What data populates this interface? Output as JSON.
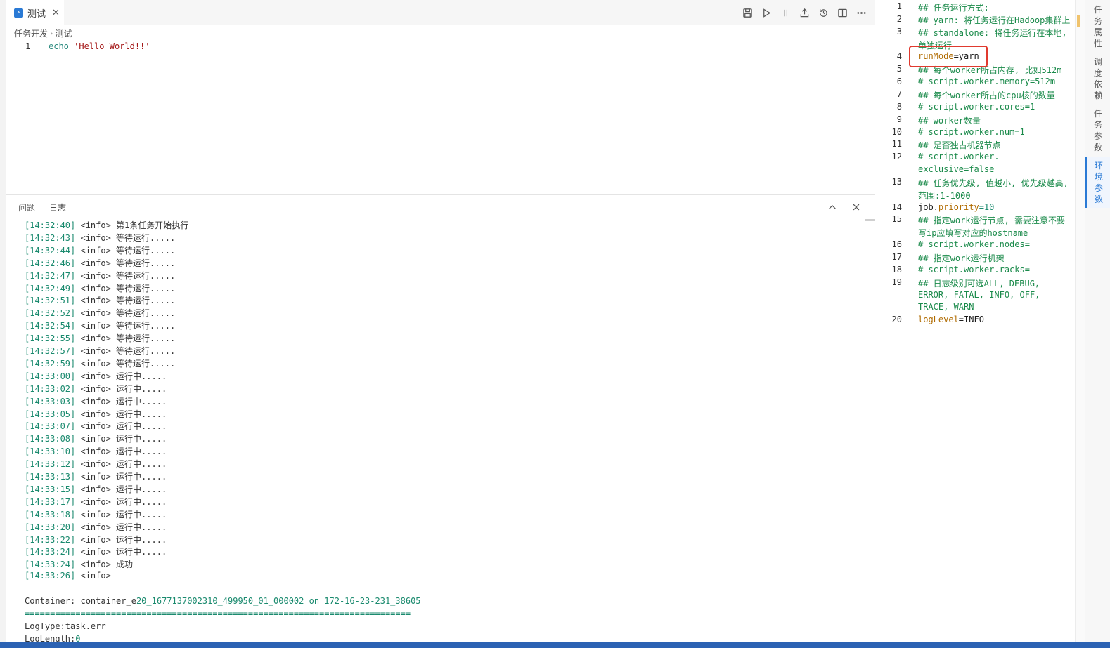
{
  "tab": {
    "title": "测试",
    "close": "✕",
    "icon": "terminal-icon"
  },
  "breadcrumb": {
    "root": "任务开发",
    "sep": "›",
    "current": "测试"
  },
  "editor": {
    "line_number": "1",
    "keyword": "echo",
    "string": "'Hello World!!'"
  },
  "panel": {
    "tabs": [
      "问题",
      "日志"
    ],
    "active_tab": "日志"
  },
  "log": {
    "lines": [
      {
        "ts": "[14:32:40]",
        "level": "<info>",
        "msg": "第1条任务开始执行"
      },
      {
        "ts": "[14:32:43]",
        "level": "<info>",
        "msg": "等待运行....."
      },
      {
        "ts": "[14:32:44]",
        "level": "<info>",
        "msg": "等待运行....."
      },
      {
        "ts": "[14:32:46]",
        "level": "<info>",
        "msg": "等待运行....."
      },
      {
        "ts": "[14:32:47]",
        "level": "<info>",
        "msg": "等待运行....."
      },
      {
        "ts": "[14:32:49]",
        "level": "<info>",
        "msg": "等待运行....."
      },
      {
        "ts": "[14:32:51]",
        "level": "<info>",
        "msg": "等待运行....."
      },
      {
        "ts": "[14:32:52]",
        "level": "<info>",
        "msg": "等待运行....."
      },
      {
        "ts": "[14:32:54]",
        "level": "<info>",
        "msg": "等待运行....."
      },
      {
        "ts": "[14:32:55]",
        "level": "<info>",
        "msg": "等待运行....."
      },
      {
        "ts": "[14:32:57]",
        "level": "<info>",
        "msg": "等待运行....."
      },
      {
        "ts": "[14:32:59]",
        "level": "<info>",
        "msg": "等待运行....."
      },
      {
        "ts": "[14:33:00]",
        "level": "<info>",
        "msg": "运行中....."
      },
      {
        "ts": "[14:33:02]",
        "level": "<info>",
        "msg": "运行中....."
      },
      {
        "ts": "[14:33:03]",
        "level": "<info>",
        "msg": "运行中....."
      },
      {
        "ts": "[14:33:05]",
        "level": "<info>",
        "msg": "运行中....."
      },
      {
        "ts": "[14:33:07]",
        "level": "<info>",
        "msg": "运行中....."
      },
      {
        "ts": "[14:33:08]",
        "level": "<info>",
        "msg": "运行中....."
      },
      {
        "ts": "[14:33:10]",
        "level": "<info>",
        "msg": "运行中....."
      },
      {
        "ts": "[14:33:12]",
        "level": "<info>",
        "msg": "运行中....."
      },
      {
        "ts": "[14:33:13]",
        "level": "<info>",
        "msg": "运行中....."
      },
      {
        "ts": "[14:33:15]",
        "level": "<info>",
        "msg": "运行中....."
      },
      {
        "ts": "[14:33:17]",
        "level": "<info>",
        "msg": "运行中....."
      },
      {
        "ts": "[14:33:18]",
        "level": "<info>",
        "msg": "运行中....."
      },
      {
        "ts": "[14:33:20]",
        "level": "<info>",
        "msg": "运行中....."
      },
      {
        "ts": "[14:33:22]",
        "level": "<info>",
        "msg": "运行中....."
      },
      {
        "ts": "[14:33:24]",
        "level": "<info>",
        "msg": "运行中....."
      },
      {
        "ts": "[14:33:24]",
        "level": "<info>",
        "msg": "成功"
      },
      {
        "ts": "[14:33:26]",
        "level": "<info>",
        "msg": ""
      }
    ],
    "container_prefix": "Container: container_e",
    "container_id": "20_1677137002310_499950_01_000002 on 172-16-23-231_38605",
    "separator": "============================================================================",
    "logtype": "LogType:task.err",
    "loglength_prefix": "LogLength:",
    "loglength_value": "0"
  },
  "config": {
    "lines": [
      {
        "n": "1",
        "parts": [
          {
            "t": "## 任务运行方式:",
            "c": "cm"
          }
        ]
      },
      {
        "n": "2",
        "parts": [
          {
            "t": "## yarn: 将任务运行在Hadoop集群上",
            "c": "cm"
          }
        ]
      },
      {
        "n": "3",
        "parts": [
          {
            "t": "## standalone: 将任务运行在本地,",
            "c": "cm"
          }
        ]
      },
      {
        "n": "",
        "parts": [
          {
            "t": "单独运行",
            "c": "cm"
          }
        ]
      },
      {
        "n": "4",
        "parts": [
          {
            "t": "runMode",
            "c": "key"
          },
          {
            "t": "=yarn",
            "c": "val"
          }
        ]
      },
      {
        "n": "5",
        "parts": [
          {
            "t": "## 每个worker所占内存, 比如512m",
            "c": "cm"
          }
        ]
      },
      {
        "n": "6",
        "parts": [
          {
            "t": "# script.worker.memory=512m",
            "c": "cm"
          }
        ]
      },
      {
        "n": "7",
        "parts": [
          {
            "t": "## 每个worker所占的cpu核的数量",
            "c": "cm"
          }
        ]
      },
      {
        "n": "8",
        "parts": [
          {
            "t": "# script.worker.cores=1",
            "c": "cm"
          }
        ]
      },
      {
        "n": "9",
        "parts": [
          {
            "t": "## worker数量",
            "c": "cm"
          }
        ]
      },
      {
        "n": "10",
        "parts": [
          {
            "t": "# script.worker.num=1",
            "c": "cm"
          }
        ]
      },
      {
        "n": "11",
        "parts": [
          {
            "t": "## 是否独占机器节点",
            "c": "cm"
          }
        ]
      },
      {
        "n": "12",
        "parts": [
          {
            "t": "# script.worker.",
            "c": "cm"
          }
        ]
      },
      {
        "n": "",
        "parts": [
          {
            "t": "exclusive=false",
            "c": "cm"
          }
        ]
      },
      {
        "n": "13",
        "parts": [
          {
            "t": "## 任务优先级, 值越小, 优先级越高,",
            "c": "cm"
          }
        ]
      },
      {
        "n": "",
        "parts": [
          {
            "t": "范围:1-1000",
            "c": "cm"
          }
        ]
      },
      {
        "n": "14",
        "parts": [
          {
            "t": "job.",
            "c": "plain"
          },
          {
            "t": "priority",
            "c": "key"
          },
          {
            "t": "=10",
            "c": "num"
          }
        ]
      },
      {
        "n": "15",
        "parts": [
          {
            "t": "## 指定work运行节点, 需要注意不要",
            "c": "cm"
          }
        ]
      },
      {
        "n": "",
        "parts": [
          {
            "t": "写ip应填写对应的hostname",
            "c": "cm"
          }
        ]
      },
      {
        "n": "16",
        "parts": [
          {
            "t": "# script.worker.nodes=",
            "c": "cm"
          }
        ]
      },
      {
        "n": "17",
        "parts": [
          {
            "t": "## 指定work运行机架",
            "c": "cm"
          }
        ]
      },
      {
        "n": "18",
        "parts": [
          {
            "t": "# script.worker.racks=",
            "c": "cm"
          }
        ]
      },
      {
        "n": "19",
        "parts": [
          {
            "t": "## 日志级别可选ALL, DEBUG,",
            "c": "cm"
          }
        ]
      },
      {
        "n": "",
        "parts": [
          {
            "t": "ERROR, FATAL, INFO, OFF,",
            "c": "cm"
          }
        ]
      },
      {
        "n": "",
        "parts": [
          {
            "t": "TRACE, WARN",
            "c": "cm"
          }
        ]
      },
      {
        "n": "20",
        "parts": [
          {
            "t": "logLevel",
            "c": "key"
          },
          {
            "t": "=INFO",
            "c": "val"
          }
        ]
      }
    ]
  },
  "side_tabs": [
    {
      "label": "任务属性",
      "active": false
    },
    {
      "label": "调度依赖",
      "active": false
    },
    {
      "label": "任务参数",
      "active": false
    },
    {
      "label": "环境参数",
      "active": true
    }
  ],
  "colors": {
    "accent": "#2a7ad5",
    "highlight_box": "#e03a2f",
    "statusbar": "#2b62b3"
  }
}
